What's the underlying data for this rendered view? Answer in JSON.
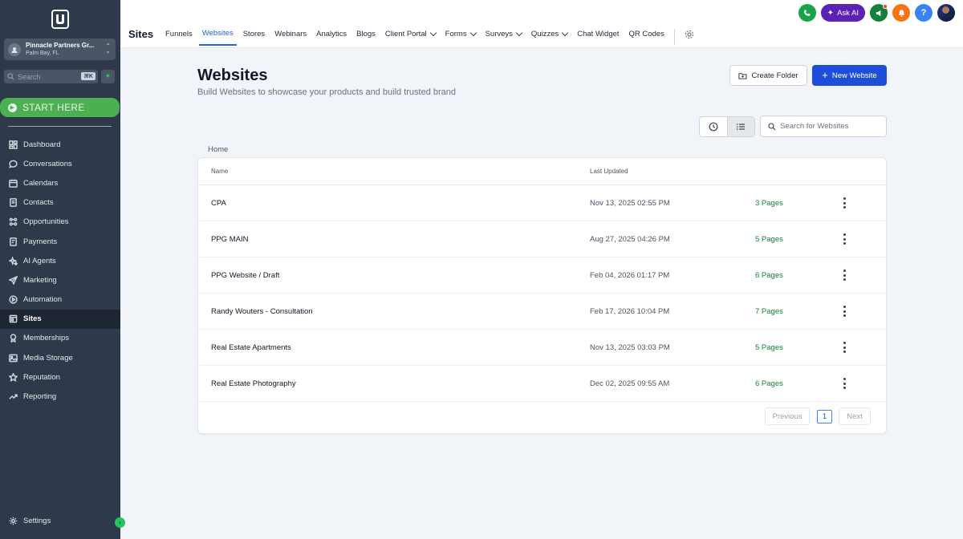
{
  "sidebar": {
    "account": {
      "name": "Pinnacle Partners Gr...",
      "location": "Palm Bay, FL"
    },
    "search": {
      "placeholder": "Search",
      "shortcut": "⌘K"
    },
    "start_here": "START HERE",
    "items": [
      {
        "label": "Dashboard",
        "icon": "dashboard-icon"
      },
      {
        "label": "Conversations",
        "icon": "chat-icon"
      },
      {
        "label": "Calendars",
        "icon": "calendar-icon"
      },
      {
        "label": "Contacts",
        "icon": "contacts-icon"
      },
      {
        "label": "Opportunities",
        "icon": "opportunities-icon"
      },
      {
        "label": "Payments",
        "icon": "payments-icon"
      },
      {
        "label": "AI Agents",
        "icon": "sparkle-icon"
      },
      {
        "label": "Marketing",
        "icon": "send-icon"
      },
      {
        "label": "Automation",
        "icon": "automation-icon"
      },
      {
        "label": "Sites",
        "icon": "sites-icon",
        "active": true
      },
      {
        "label": "Memberships",
        "icon": "award-icon"
      },
      {
        "label": "Media Storage",
        "icon": "image-icon"
      },
      {
        "label": "Reputation",
        "icon": "star-icon"
      },
      {
        "label": "Reporting",
        "icon": "trend-icon"
      }
    ],
    "settings": "Settings"
  },
  "header": {
    "title": "Sites",
    "tabs": [
      {
        "label": "Funnels"
      },
      {
        "label": "Websites",
        "active": true
      },
      {
        "label": "Stores"
      },
      {
        "label": "Webinars"
      },
      {
        "label": "Analytics"
      },
      {
        "label": "Blogs"
      },
      {
        "label": "Client Portal",
        "dropdown": true
      },
      {
        "label": "Forms",
        "dropdown": true
      },
      {
        "label": "Surveys",
        "dropdown": true
      },
      {
        "label": "Quizzes",
        "dropdown": true
      },
      {
        "label": "Chat Widget"
      },
      {
        "label": "QR Codes"
      }
    ],
    "ask_ai": "Ask AI",
    "colors": {
      "phone": "#16a34a",
      "ask_ai": "#5b21b6",
      "megaphone": "#15803d",
      "bell": "#f97316",
      "help": "#3b82f6"
    }
  },
  "main": {
    "title": "Websites",
    "subtitle": "Build Websites to showcase your products and build trusted brand",
    "create_folder": "Create Folder",
    "new_website": "New Website",
    "search_placeholder": "Search for Websites",
    "breadcrumb": "Home",
    "columns": {
      "name": "Name",
      "last_updated": "Last Updated"
    },
    "rows": [
      {
        "name": "CPA",
        "updated": "Nov 13, 2025 02:55 PM",
        "pages": "3 Pages"
      },
      {
        "name": "PPG MAIN",
        "updated": "Aug 27, 2025 04:26 PM",
        "pages": "5 Pages"
      },
      {
        "name": "PPG Website / Draft",
        "updated": "Feb 04, 2026 01:17 PM",
        "pages": "6 Pages"
      },
      {
        "name": "Randy Wouters  - Consultation",
        "updated": "Feb 17, 2026 10:04 PM",
        "pages": "7 Pages"
      },
      {
        "name": "Real Estate Apartments",
        "updated": "Nov 13, 2025 03:03 PM",
        "pages": "5 Pages"
      },
      {
        "name": "Real Estate Photography",
        "updated": "Dec 02, 2025 09:55 AM",
        "pages": "6 Pages"
      }
    ],
    "pagination": {
      "previous": "Previous",
      "page": "1",
      "next": "Next"
    }
  }
}
